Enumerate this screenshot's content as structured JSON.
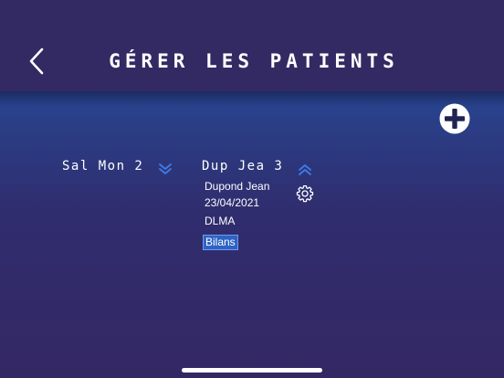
{
  "header": {
    "title": "GÉRER LES PATIENTS",
    "back_icon": "chevron-left-icon",
    "add_icon": "plus-circle-icon"
  },
  "patients": [
    {
      "code": "Sal Mon 2",
      "expanded": false,
      "toggle_icon": "double-chevron-down-icon"
    },
    {
      "code": "Dup Jea 3",
      "expanded": true,
      "toggle_icon": "double-chevron-up-icon",
      "name": "Dupond Jean",
      "date": "23/04/2021",
      "type": "DLMA",
      "settings_icon": "gear-icon",
      "bilans_label": "Bilans"
    }
  ],
  "colors": {
    "header_bg": "#332a63",
    "background_top": "#2250a6",
    "background_bottom": "#342864",
    "accent_blue": "#3f7be8",
    "button_blue": "#2f62c4",
    "text": "#ffffff"
  }
}
